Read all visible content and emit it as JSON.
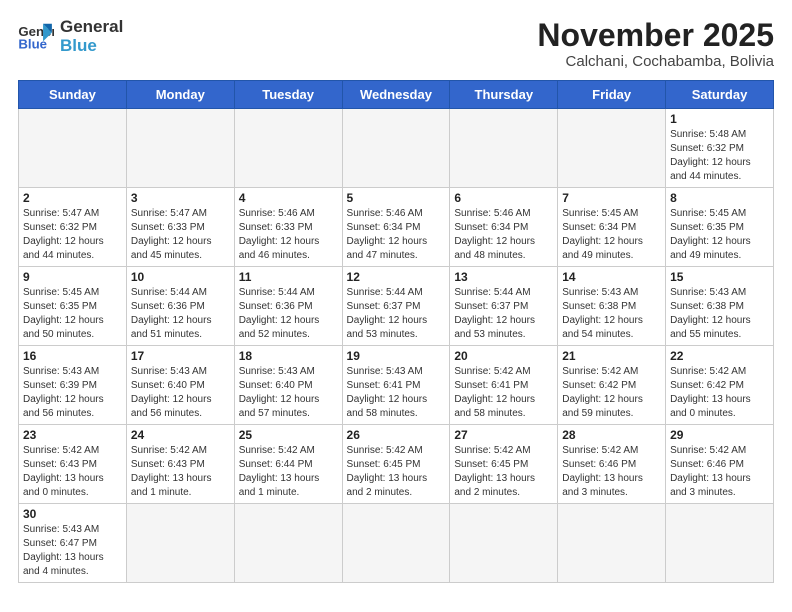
{
  "logo": {
    "line1": "General",
    "line2": "Blue"
  },
  "title": "November 2025",
  "subtitle": "Calchani, Cochabamba, Bolivia",
  "weekdays": [
    "Sunday",
    "Monday",
    "Tuesday",
    "Wednesday",
    "Thursday",
    "Friday",
    "Saturday"
  ],
  "weeks": [
    [
      {
        "day": "",
        "info": ""
      },
      {
        "day": "",
        "info": ""
      },
      {
        "day": "",
        "info": ""
      },
      {
        "day": "",
        "info": ""
      },
      {
        "day": "",
        "info": ""
      },
      {
        "day": "",
        "info": ""
      },
      {
        "day": "1",
        "info": "Sunrise: 5:48 AM\nSunset: 6:32 PM\nDaylight: 12 hours\nand 44 minutes."
      }
    ],
    [
      {
        "day": "2",
        "info": "Sunrise: 5:47 AM\nSunset: 6:32 PM\nDaylight: 12 hours\nand 44 minutes."
      },
      {
        "day": "3",
        "info": "Sunrise: 5:47 AM\nSunset: 6:33 PM\nDaylight: 12 hours\nand 45 minutes."
      },
      {
        "day": "4",
        "info": "Sunrise: 5:46 AM\nSunset: 6:33 PM\nDaylight: 12 hours\nand 46 minutes."
      },
      {
        "day": "5",
        "info": "Sunrise: 5:46 AM\nSunset: 6:34 PM\nDaylight: 12 hours\nand 47 minutes."
      },
      {
        "day": "6",
        "info": "Sunrise: 5:46 AM\nSunset: 6:34 PM\nDaylight: 12 hours\nand 48 minutes."
      },
      {
        "day": "7",
        "info": "Sunrise: 5:45 AM\nSunset: 6:34 PM\nDaylight: 12 hours\nand 49 minutes."
      },
      {
        "day": "8",
        "info": "Sunrise: 5:45 AM\nSunset: 6:35 PM\nDaylight: 12 hours\nand 49 minutes."
      }
    ],
    [
      {
        "day": "9",
        "info": "Sunrise: 5:45 AM\nSunset: 6:35 PM\nDaylight: 12 hours\nand 50 minutes."
      },
      {
        "day": "10",
        "info": "Sunrise: 5:44 AM\nSunset: 6:36 PM\nDaylight: 12 hours\nand 51 minutes."
      },
      {
        "day": "11",
        "info": "Sunrise: 5:44 AM\nSunset: 6:36 PM\nDaylight: 12 hours\nand 52 minutes."
      },
      {
        "day": "12",
        "info": "Sunrise: 5:44 AM\nSunset: 6:37 PM\nDaylight: 12 hours\nand 53 minutes."
      },
      {
        "day": "13",
        "info": "Sunrise: 5:44 AM\nSunset: 6:37 PM\nDaylight: 12 hours\nand 53 minutes."
      },
      {
        "day": "14",
        "info": "Sunrise: 5:43 AM\nSunset: 6:38 PM\nDaylight: 12 hours\nand 54 minutes."
      },
      {
        "day": "15",
        "info": "Sunrise: 5:43 AM\nSunset: 6:38 PM\nDaylight: 12 hours\nand 55 minutes."
      }
    ],
    [
      {
        "day": "16",
        "info": "Sunrise: 5:43 AM\nSunset: 6:39 PM\nDaylight: 12 hours\nand 56 minutes."
      },
      {
        "day": "17",
        "info": "Sunrise: 5:43 AM\nSunset: 6:40 PM\nDaylight: 12 hours\nand 56 minutes."
      },
      {
        "day": "18",
        "info": "Sunrise: 5:43 AM\nSunset: 6:40 PM\nDaylight: 12 hours\nand 57 minutes."
      },
      {
        "day": "19",
        "info": "Sunrise: 5:43 AM\nSunset: 6:41 PM\nDaylight: 12 hours\nand 58 minutes."
      },
      {
        "day": "20",
        "info": "Sunrise: 5:42 AM\nSunset: 6:41 PM\nDaylight: 12 hours\nand 58 minutes."
      },
      {
        "day": "21",
        "info": "Sunrise: 5:42 AM\nSunset: 6:42 PM\nDaylight: 12 hours\nand 59 minutes."
      },
      {
        "day": "22",
        "info": "Sunrise: 5:42 AM\nSunset: 6:42 PM\nDaylight: 13 hours\nand 0 minutes."
      }
    ],
    [
      {
        "day": "23",
        "info": "Sunrise: 5:42 AM\nSunset: 6:43 PM\nDaylight: 13 hours\nand 0 minutes."
      },
      {
        "day": "24",
        "info": "Sunrise: 5:42 AM\nSunset: 6:43 PM\nDaylight: 13 hours\nand 1 minute."
      },
      {
        "day": "25",
        "info": "Sunrise: 5:42 AM\nSunset: 6:44 PM\nDaylight: 13 hours\nand 1 minute."
      },
      {
        "day": "26",
        "info": "Sunrise: 5:42 AM\nSunset: 6:45 PM\nDaylight: 13 hours\nand 2 minutes."
      },
      {
        "day": "27",
        "info": "Sunrise: 5:42 AM\nSunset: 6:45 PM\nDaylight: 13 hours\nand 2 minutes."
      },
      {
        "day": "28",
        "info": "Sunrise: 5:42 AM\nSunset: 6:46 PM\nDaylight: 13 hours\nand 3 minutes."
      },
      {
        "day": "29",
        "info": "Sunrise: 5:42 AM\nSunset: 6:46 PM\nDaylight: 13 hours\nand 3 minutes."
      }
    ],
    [
      {
        "day": "30",
        "info": "Sunrise: 5:43 AM\nSunset: 6:47 PM\nDaylight: 13 hours\nand 4 minutes."
      },
      {
        "day": "",
        "info": ""
      },
      {
        "day": "",
        "info": ""
      },
      {
        "day": "",
        "info": ""
      },
      {
        "day": "",
        "info": ""
      },
      {
        "day": "",
        "info": ""
      },
      {
        "day": "",
        "info": ""
      }
    ]
  ]
}
